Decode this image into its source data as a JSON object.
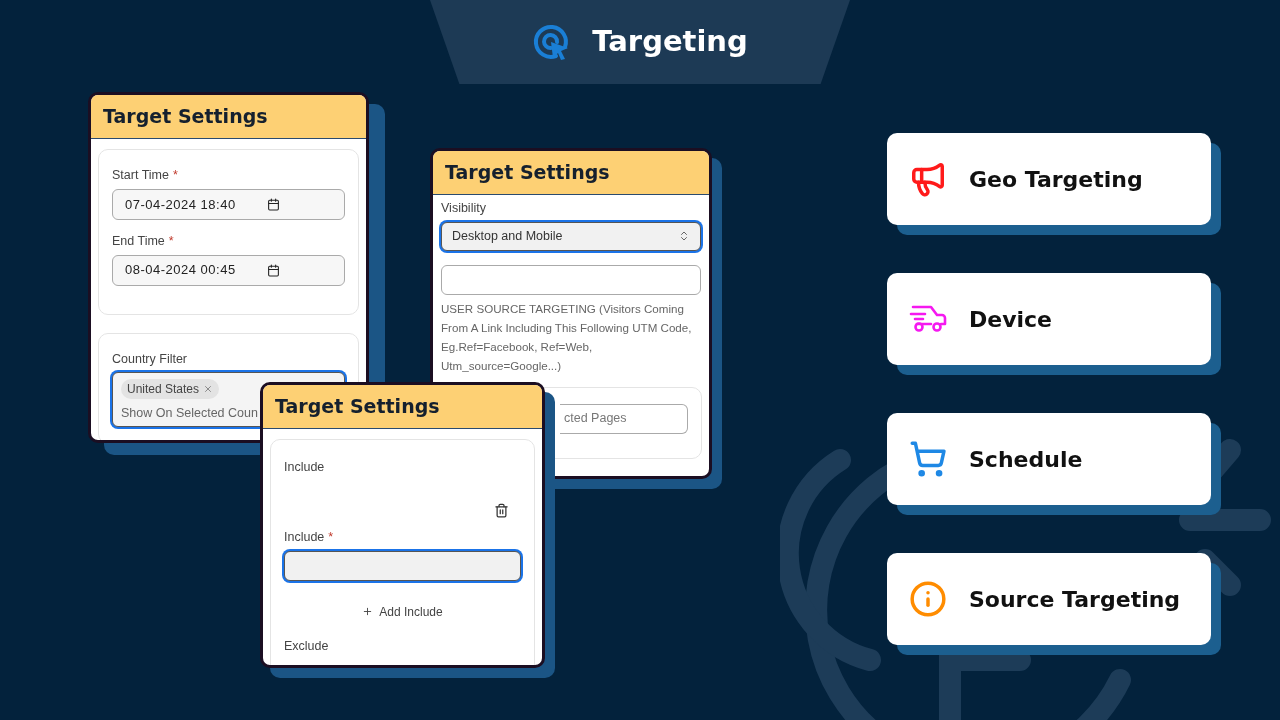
{
  "banner": {
    "title": "Targeting"
  },
  "panels": [
    {
      "title": "Target Settings",
      "sections": [
        {
          "boxed": true,
          "fields": [
            {
              "kind": "datetime",
              "label": "Start Time",
              "required_mark": "*",
              "value": "07-04-2024 18:40",
              "focused": false
            },
            {
              "kind": "datetime",
              "label": "End Time",
              "required_mark": "*",
              "value": "08-04-2024 00:45",
              "focused": false
            }
          ]
        },
        {
          "boxed": true,
          "fields": [
            {
              "kind": "tags",
              "label": "Country Filter",
              "tags": [
                "United States"
              ],
              "placeholder": "Show On Selected Coun",
              "focused": true
            }
          ]
        }
      ]
    },
    {
      "title": "Target Settings",
      "sections": [
        {
          "fields": [
            {
              "kind": "select",
              "label": "Visibility",
              "value": "Desktop and Mobile",
              "focused": true
            },
            {
              "kind": "text",
              "focused": false,
              "help": "USER SOURCE TARGETING (Visitors Coming From A Link Including This Following UTM Code, Eg.Ref=Facebook, Ref=Web, Utm_source=Google...)"
            }
          ]
        },
        {
          "boxed": true,
          "fields": [
            {
              "kind": "text",
              "placeholder": "cted Pages",
              "focused": false
            }
          ]
        }
      ]
    },
    {
      "title": "Target Settings",
      "sections": [
        {
          "boxed": true,
          "fields": [
            {
              "kind": "heading",
              "label": "Include"
            },
            {
              "kind": "delete"
            },
            {
              "kind": "text",
              "label": "Include",
              "required_mark": "*",
              "focused": true
            },
            {
              "kind": "add",
              "label": "Add Include"
            },
            {
              "kind": "heading",
              "label": "Exclude"
            }
          ]
        }
      ]
    }
  ],
  "features": [
    {
      "kind": "megaphone",
      "label": "Geo Targeting",
      "color": "#ff1a1a"
    },
    {
      "kind": "truck",
      "label": "Device",
      "color": "#f518f0"
    },
    {
      "kind": "cart",
      "label": "Schedule",
      "color": "#1e88e5"
    },
    {
      "kind": "info",
      "label": "Source Targeting",
      "color": "#ff8c00"
    }
  ]
}
